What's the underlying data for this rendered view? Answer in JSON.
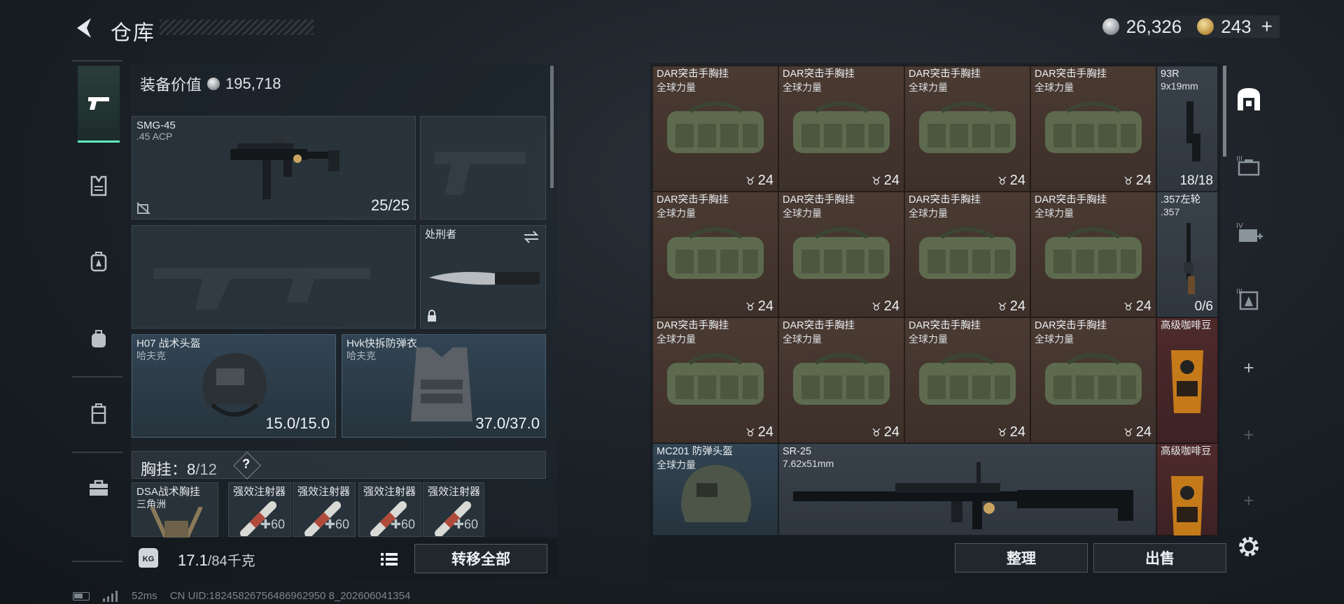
{
  "header": {
    "title": "仓库",
    "silver_amount": "26,326",
    "gold_amount": "243",
    "gold_plus": "+"
  },
  "nav": {
    "items": [
      "weapons",
      "armor",
      "backpack",
      "bags",
      "rig",
      "toolbox"
    ]
  },
  "left": {
    "equip_value_label": "装备价值",
    "equip_value": "195,718",
    "primary": {
      "name": "SMG-45",
      "ammo": ".45 ACP",
      "count": "25/25"
    },
    "melee": {
      "name": "处刑者"
    },
    "helmet": {
      "name": "H07 战术头盔",
      "brand": "哈夫克",
      "durability": "15.0/15.0"
    },
    "armor": {
      "name": "Hvk快拆防弹衣",
      "brand": "哈夫克",
      "durability": "37.0/37.0"
    },
    "rig": {
      "label": "胸挂：",
      "current": "8",
      "capacity": "/12",
      "help": "?",
      "item_name": "DSA战术胸挂",
      "item_brand": "三角洲",
      "injectors": [
        "强效注射器",
        "强效注射器",
        "强效注射器",
        "强效注射器"
      ],
      "injector_count": "60"
    },
    "weight": {
      "current": "17.1",
      "max": "/84千克"
    },
    "weight_icon_text": "KG",
    "transfer_all": "转移全部"
  },
  "status": {
    "ping": "52ms",
    "uid": "CN UID:18245826756486962950 8_202606041354"
  },
  "grid": {
    "rig_name": "DAR突击手胸挂",
    "rig_brand": "全球力量",
    "rig_count": "24",
    "rows": [
      [
        {
          "k": "rig"
        },
        {
          "k": "rig"
        },
        {
          "k": "rig"
        },
        {
          "k": "rig"
        }
      ],
      [
        {
          "k": "rig"
        },
        {
          "k": "rig"
        },
        {
          "k": "rig"
        },
        {
          "k": "rig"
        }
      ],
      [
        {
          "k": "rig"
        },
        {
          "k": "rig"
        },
        {
          "k": "rig"
        },
        {
          "k": "rig"
        }
      ]
    ],
    "pistol": {
      "name": "93R",
      "ammo": "9x19mm",
      "count": "18/18"
    },
    "revolver": {
      "name": ".357左轮",
      "ammo": ".357",
      "count": "0/6"
    },
    "coffee1": {
      "name": "高级咖啡豆"
    },
    "coffee2": {
      "name": "高级咖啡豆"
    },
    "helmet": {
      "name": "MC201 防弹头盔",
      "brand": "全球力量"
    },
    "rifle": {
      "name": "SR-25",
      "ammo": "7.62x51mm"
    }
  },
  "actions": {
    "sort": "整理",
    "sell": "出售"
  },
  "colors": {
    "accent": "#5ef0c0",
    "rig_cell": "#4a3a32",
    "rare_cell": "#4e2a2b",
    "blue_cell": "#324554"
  }
}
